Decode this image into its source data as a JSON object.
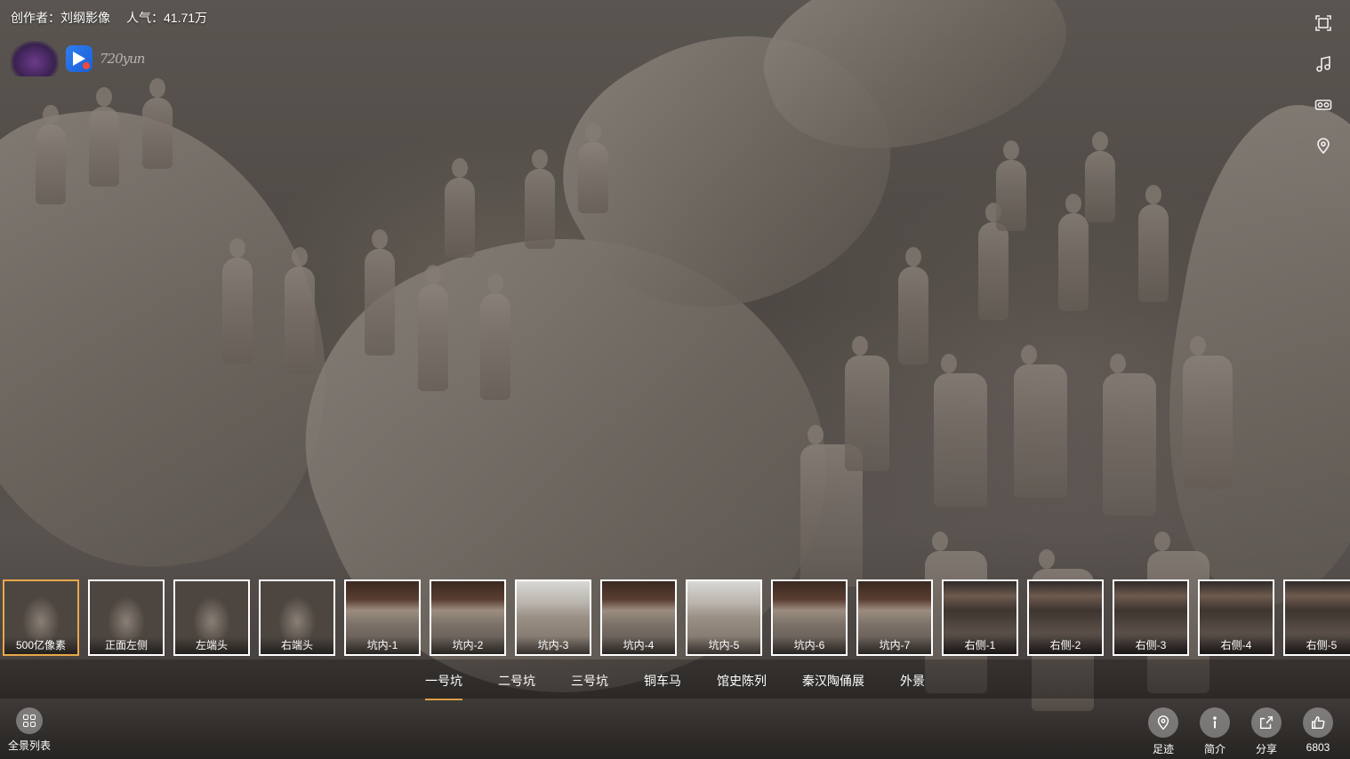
{
  "header": {
    "creator": "创作者：刘纲影像",
    "popularity": "人气：41.71万",
    "logo_text": "720yun"
  },
  "side_icons": [
    "fullscreen-icon",
    "music-icon",
    "vr-glasses-icon",
    "location-pin-icon"
  ],
  "thumbnails": [
    {
      "label": "500亿像素",
      "active": true
    },
    {
      "label": "正面左侧",
      "active": false
    },
    {
      "label": "左端头",
      "active": false
    },
    {
      "label": "右端头",
      "active": false
    },
    {
      "label": "坑内-1",
      "active": false
    },
    {
      "label": "坑内-2",
      "active": false
    },
    {
      "label": "坑内-3",
      "active": false
    },
    {
      "label": "坑内-4",
      "active": false
    },
    {
      "label": "坑内-5",
      "active": false
    },
    {
      "label": "坑内-6",
      "active": false
    },
    {
      "label": "坑内-7",
      "active": false
    },
    {
      "label": "右侧-1",
      "active": false
    },
    {
      "label": "右侧-2",
      "active": false
    },
    {
      "label": "右侧-3",
      "active": false
    },
    {
      "label": "右侧-4",
      "active": false
    },
    {
      "label": "右侧-5",
      "active": false
    }
  ],
  "tabs": [
    {
      "label": "一号坑",
      "active": true
    },
    {
      "label": "二号坑",
      "active": false
    },
    {
      "label": "三号坑",
      "active": false
    },
    {
      "label": "铜车马",
      "active": false
    },
    {
      "label": "馆史陈列",
      "active": false
    },
    {
      "label": "秦汉陶俑展",
      "active": false
    },
    {
      "label": "外景",
      "active": false
    }
  ],
  "bottom": {
    "pano_list_label": "全景列表",
    "actions": [
      {
        "icon": "footprint-pin-icon",
        "label": "足迹"
      },
      {
        "icon": "info-icon",
        "label": "简介"
      },
      {
        "icon": "share-icon",
        "label": "分享"
      },
      {
        "icon": "thumbs-up-icon",
        "label": "6803"
      }
    ]
  },
  "colors": {
    "accent": "#e8a84a",
    "text": "#ffffff"
  }
}
